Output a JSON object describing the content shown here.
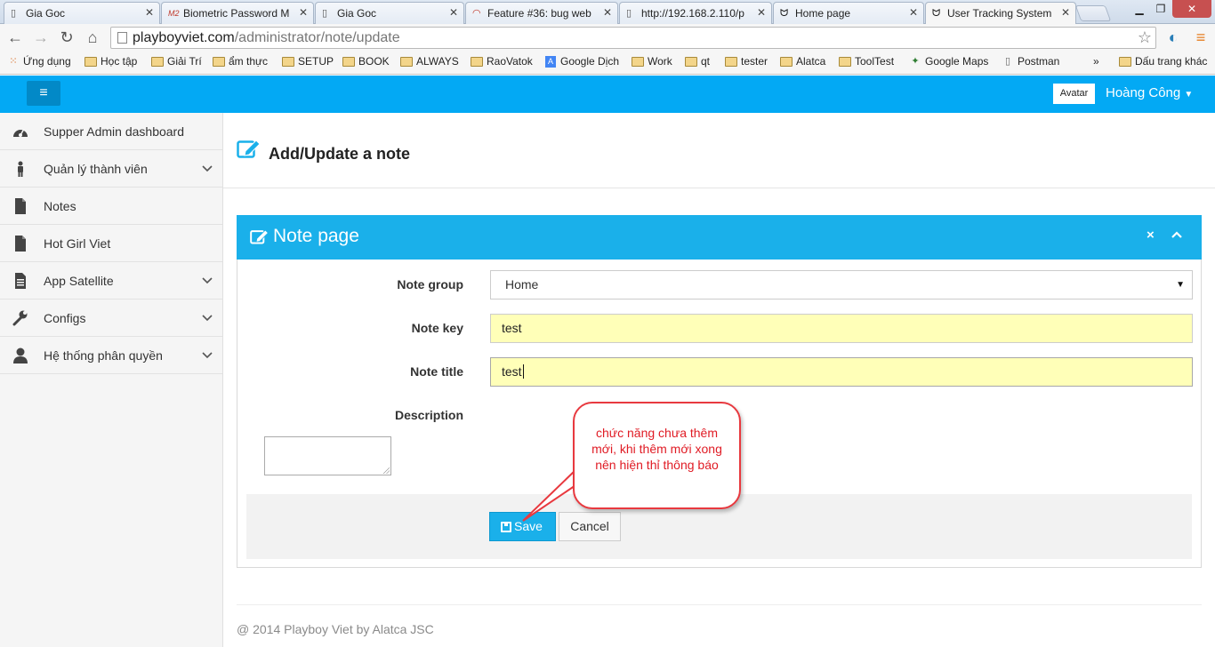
{
  "browser": {
    "tabs": [
      {
        "title": "Gia Goc",
        "active": false
      },
      {
        "title": "Biometric Password M",
        "active": false
      },
      {
        "title": "Gia Goc",
        "active": false
      },
      {
        "title": "Feature #36: bug web",
        "active": false
      },
      {
        "title": "http://192.168.2.110/p",
        "active": false
      },
      {
        "title": "Home page",
        "active": false
      },
      {
        "title": "User Tracking System",
        "active": true
      }
    ],
    "url_host": "playboyviet.com",
    "url_path": "/administrator/note/update",
    "bookmarks": [
      "Ứng dụng",
      "Học tập",
      "Giải Trí",
      "ẩm thực",
      "SETUP",
      "BOOK",
      "ALWAYS",
      "RaoVatok",
      "Google Dịch",
      "Work",
      "qt",
      "tester",
      "Alatca",
      "ToolTest",
      "Google Maps",
      "Postman"
    ],
    "bookmarks_overflow": "»",
    "other_bookmarks": "Dấu trang khác"
  },
  "topbar": {
    "avatar_label": "Avatar",
    "user_name": "Hoàng Công"
  },
  "sidebar": {
    "items": [
      {
        "label": "Supper Admin dashboard",
        "icon": "dashboard-icon",
        "expandable": false
      },
      {
        "label": "Quản lý thành viên",
        "icon": "user-icon",
        "expandable": true
      },
      {
        "label": "Notes",
        "icon": "file-icon",
        "expandable": false
      },
      {
        "label": "Hot Girl Viet",
        "icon": "file-icon",
        "expandable": false
      },
      {
        "label": "App Satellite",
        "icon": "file-text-icon",
        "expandable": true
      },
      {
        "label": "Configs",
        "icon": "wrench-icon",
        "expandable": true
      },
      {
        "label": "Hệ thống phân quyền",
        "icon": "person-icon",
        "expandable": true
      }
    ]
  },
  "page": {
    "title": "Add/Update a note"
  },
  "panel": {
    "title": "Note page",
    "close_glyph": "×",
    "fields": {
      "group_label": "Note group",
      "group_value": "Home",
      "key_label": "Note key",
      "key_value": "test",
      "title_label": "Note title",
      "title_value": "test",
      "description_label": "Description",
      "description_value": ""
    },
    "save_label": "Save",
    "cancel_label": "Cancel"
  },
  "annotation": {
    "text": "chức năng chưa thêm mới, khi thêm mới xong nên hiện thỉ thông báo",
    "color": "#e01b24"
  },
  "footer": {
    "text": "@ 2014 Playboy Viet by Alatca JSC"
  },
  "colors": {
    "accent": "#03a9f4",
    "panel_header": "#1ab0ea",
    "input_autofill": "#ffffb8"
  }
}
